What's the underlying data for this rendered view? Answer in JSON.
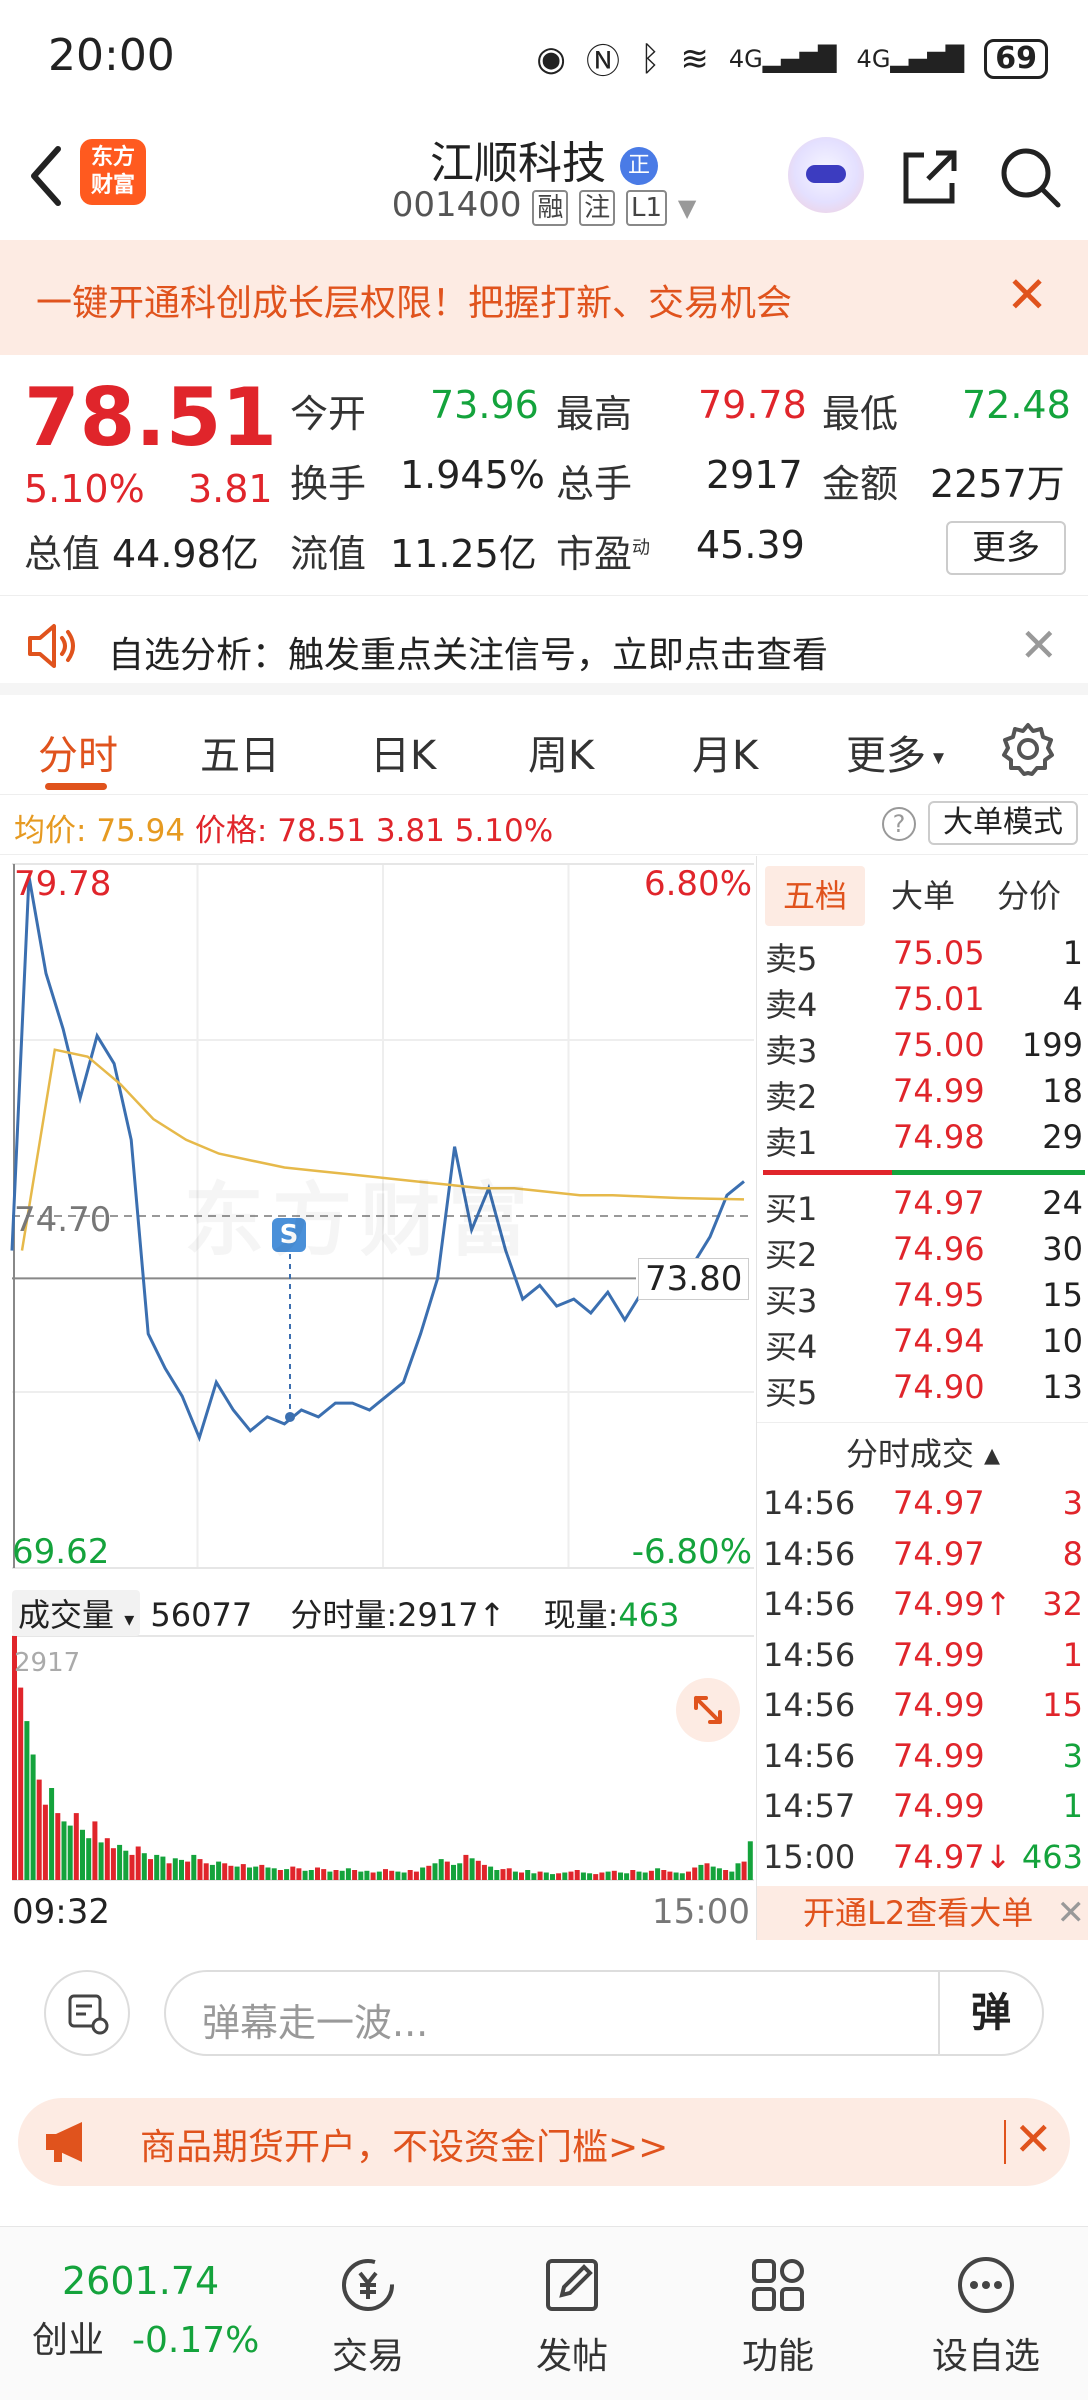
{
  "status": {
    "time": "20:00",
    "battery": "69",
    "net1": "4G",
    "net2": "4G"
  },
  "header": {
    "logo_line1": "东方",
    "logo_line2": "财富",
    "stock_name": "江顺科技",
    "badge": "正",
    "stock_code": "001400",
    "tags": [
      "融",
      "注",
      "L1"
    ]
  },
  "banner": {
    "text": "一键开通科创成长层权限！把握打新、交易机会",
    "close": "✕"
  },
  "quote": {
    "price": "78.51",
    "pct": "5.10%",
    "change": "3.81",
    "open_label": "今开",
    "open": "73.96",
    "high_label": "最高",
    "high": "79.78",
    "low_label": "最低",
    "low": "72.48",
    "turnover_label": "换手",
    "turnover": "1.945%",
    "volume_label": "总手",
    "volume": "2917",
    "amount_label": "金额",
    "amount": "2257万",
    "mcap_label": "总值",
    "mcap": "44.98亿",
    "float_label": "流值",
    "float": "11.25亿",
    "pe_label": "市盈",
    "pe_sup": "动",
    "pe": "45.39",
    "more": "更多"
  },
  "alert": {
    "text": "自选分析：触发重点关注信号，立即点击查看",
    "close": "✕"
  },
  "tabs": {
    "items": [
      "分时",
      "五日",
      "日K",
      "周K",
      "月K",
      "更多"
    ],
    "active": "分时"
  },
  "info": {
    "avg_label": "均价:",
    "avg": "75.94",
    "price_label": "价格:",
    "price": "78.51",
    "change": "3.81",
    "pct": "5.10%",
    "help": "?",
    "big_order": "大单模式"
  },
  "chart": {
    "price_max": "79.78",
    "price_min": "69.62",
    "pct_max": "6.80%",
    "pct_min": "-6.80%",
    "base_price": "74.70",
    "crosshair_price": "73.80",
    "s_marker": "S",
    "watermark": "东方财富",
    "vol_selector": "成交量",
    "vol_total": "56077",
    "vol_fen_label": "分时量:",
    "vol_fen": "2917",
    "vol_now_label": "现量:",
    "vol_now": "463",
    "vol_max": "2917",
    "time_start": "09:32",
    "time_end": "15:00"
  },
  "chart_data": {
    "type": "line",
    "x_range": [
      "09:30",
      "15:00"
    ],
    "ylim": [
      69.62,
      79.78
    ],
    "base": 74.7,
    "series": [
      {
        "values": [
          74.2,
          79.6,
          78.2,
          77.4,
          76.4,
          77.3,
          76.9,
          75.8,
          73.0,
          72.5,
          72.1,
          71.5,
          72.3,
          71.9,
          71.6,
          71.8,
          71.7,
          71.9,
          71.8,
          72.0,
          72.0,
          71.9,
          72.1,
          72.3,
          73.0,
          73.8,
          75.7,
          74.5,
          75.1,
          74.2,
          73.5,
          73.7,
          73.4,
          73.5,
          73.3,
          73.6,
          73.2,
          73.6,
          73.8,
          73.9,
          74.0,
          74.4,
          75.0,
          75.2
        ]
      },
      {
        "values": [
          74.2,
          77.1,
          77.0,
          76.6,
          76.1,
          75.8,
          75.6,
          75.5,
          75.4,
          75.35,
          75.3,
          75.25,
          75.2,
          75.15,
          75.1,
          75.1,
          75.05,
          75.0,
          75.0,
          74.98,
          74.96,
          74.95,
          74.94
        ]
      }
    ],
    "volume": {
      "max": 2917,
      "bars": [
        2917,
        2300,
        1900,
        1500,
        1200,
        900,
        1100,
        800,
        700,
        650,
        800,
        600,
        500,
        700,
        450,
        500,
        380,
        420,
        350,
        300,
        400,
        320,
        250,
        300,
        280,
        200,
        260,
        240,
        220,
        300,
        250,
        200,
        180,
        220,
        200,
        170,
        160,
        190,
        150,
        160,
        180,
        150,
        140,
        120,
        130,
        160,
        140,
        110,
        120,
        150,
        130,
        100,
        120,
        110,
        140,
        120,
        100,
        110,
        90,
        100,
        130,
        110,
        100,
        90,
        120,
        100,
        150,
        170,
        200,
        250,
        220,
        180,
        200,
        300,
        260,
        230,
        180,
        160,
        120,
        130,
        140,
        100,
        90,
        120,
        80,
        100,
        90,
        70,
        80,
        90,
        100,
        120,
        90,
        80,
        70,
        90,
        100,
        110,
        90,
        80,
        120,
        100,
        90,
        110,
        140,
        120,
        100,
        90,
        80,
        100,
        150,
        180,
        200,
        160,
        140,
        120,
        100,
        200,
        220,
        463
      ]
    }
  },
  "orderbook": {
    "tabs": [
      "五档",
      "大单",
      "分价"
    ],
    "sell": [
      {
        "name": "卖5",
        "price": "75.05",
        "vol": "1"
      },
      {
        "name": "卖4",
        "price": "75.01",
        "vol": "4"
      },
      {
        "name": "卖3",
        "price": "75.00",
        "vol": "199"
      },
      {
        "name": "卖2",
        "price": "74.99",
        "vol": "18"
      },
      {
        "name": "卖1",
        "price": "74.98",
        "vol": "29"
      }
    ],
    "buy": [
      {
        "name": "买1",
        "price": "74.97",
        "vol": "24"
      },
      {
        "name": "买2",
        "price": "74.96",
        "vol": "30"
      },
      {
        "name": "买3",
        "price": "74.95",
        "vol": "15"
      },
      {
        "name": "买4",
        "price": "74.94",
        "vol": "10"
      },
      {
        "name": "买5",
        "price": "74.90",
        "vol": "13"
      }
    ],
    "ticks_header": "分时成交 ▴",
    "ticks": [
      {
        "time": "14:56",
        "price": "74.97",
        "vol": "3",
        "color": "red"
      },
      {
        "time": "14:56",
        "price": "74.97",
        "vol": "8",
        "color": "red"
      },
      {
        "time": "14:56",
        "price": "74.99↑",
        "vol": "32",
        "color": "red"
      },
      {
        "time": "14:56",
        "price": "74.99",
        "vol": "1",
        "color": "red"
      },
      {
        "time": "14:56",
        "price": "74.99",
        "vol": "15",
        "color": "red"
      },
      {
        "time": "14:56",
        "price": "74.99",
        "vol": "3",
        "color": "green"
      },
      {
        "time": "14:57",
        "price": "74.99",
        "vol": "1",
        "color": "green"
      },
      {
        "time": "15:00",
        "price": "74.97↓",
        "vol": "463",
        "color": "green"
      }
    ],
    "l2_banner": "开通L2查看大单",
    "l2_close": "✕"
  },
  "comment": {
    "placeholder": "弹幕走一波...",
    "dan": "弹"
  },
  "ad": {
    "text": "商品期货开户，不设资金门槛>>",
    "close": "✕"
  },
  "bottom_nav": {
    "index_value": "2601.74",
    "index_name": "创业",
    "index_pct": "-0.17%",
    "items": [
      "交易",
      "发帖",
      "功能",
      "设自选"
    ]
  },
  "colors": {
    "up": "#e0252b",
    "down": "#14a33c",
    "accent": "#e0531d",
    "line": "#3b6fb0",
    "avg": "#e6b94a"
  }
}
